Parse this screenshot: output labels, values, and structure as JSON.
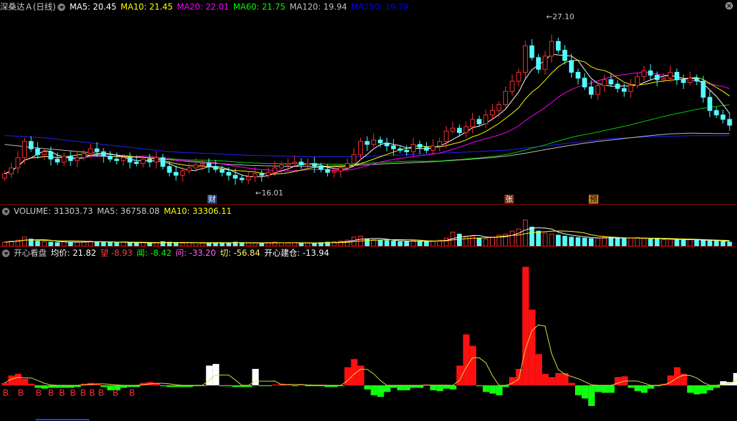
{
  "main_panel": {
    "title": "深桑达Ａ(日线)",
    "ma_labels": [
      {
        "text": "MA5: 20.45",
        "color": "#ffffff"
      },
      {
        "text": "MA10: 21.45",
        "color": "#ffff00"
      },
      {
        "text": "MA20: 22.01",
        "color": "#ff00ff"
      },
      {
        "text": "MA60: 21.75",
        "color": "#00ff00"
      },
      {
        "text": "MA120: 19.94",
        "color": "#c0c0c0"
      },
      {
        "text": "MA250: 19.79",
        "color": "#0000ff"
      }
    ],
    "high_label": "27.10",
    "low_label": "16.01",
    "badges": [
      {
        "text": "财",
        "bg": "#204080",
        "color": "#ffffff"
      },
      {
        "text": "张",
        "bg": "#7a2a10",
        "color": "#ffffff"
      },
      {
        "text": "预",
        "bg": "#c87a20",
        "color": "#000000"
      }
    ]
  },
  "volume_panel": {
    "title": "VOLUME: 31303.73",
    "ma5": "MA5: 36758.08",
    "ma10": "MA10: 33306.11"
  },
  "indicator_panel": {
    "title": "开心看盘",
    "items": [
      {
        "text": "均价: 21.82",
        "color": "#ffffff"
      },
      {
        "text": "望 -8.93",
        "color": "#ff4040"
      },
      {
        "text": "闻: -8.42",
        "color": "#00ff00"
      },
      {
        "text": "问: -33.20",
        "color": "#ff66ff"
      },
      {
        "text": "切: -56.84",
        "color": "#ffff66"
      },
      {
        "text": "开心建仓: -13.94",
        "color": "#ffffff"
      }
    ],
    "signal_label": "B"
  },
  "chart_data": {
    "type": "candlestick",
    "price_range": [
      15.5,
      27.8
    ],
    "high": 27.1,
    "low": 16.01,
    "closes": [
      17.2,
      17.6,
      18.3,
      19.4,
      18.9,
      18.5,
      18.7,
      18.2,
      18.0,
      18.4,
      18.1,
      18.3,
      18.6,
      18.9,
      18.7,
      18.4,
      18.2,
      18.1,
      18.3,
      18.0,
      17.9,
      18.2,
      18.0,
      18.3,
      17.7,
      17.3,
      17.1,
      17.4,
      17.6,
      17.8,
      17.9,
      17.7,
      17.5,
      17.3,
      17.1,
      16.9,
      16.8,
      17.0,
      17.2,
      17.1,
      17.3,
      17.6,
      17.8,
      17.9,
      18.0,
      17.8,
      17.9,
      17.7,
      17.5,
      17.3,
      17.4,
      17.6,
      17.9,
      18.5,
      19.4,
      19.2,
      19.5,
      19.3,
      19.1,
      18.9,
      18.8,
      18.7,
      19.2,
      19.0,
      18.8,
      19.1,
      19.4,
      20.1,
      20.3,
      20.0,
      20.4,
      20.9,
      20.6,
      21.2,
      21.5,
      21.9,
      22.8,
      23.5,
      24.1,
      25.9,
      25.1,
      24.3,
      25.2,
      26.2,
      25.6,
      24.9,
      24.1,
      23.7,
      23.1,
      22.6,
      23.2,
      23.6,
      23.3,
      23.0,
      22.8,
      23.2,
      23.8,
      24.2,
      23.9,
      23.6,
      23.7,
      24.1,
      23.6,
      23.4,
      23.7,
      23.5,
      22.4,
      21.5,
      21.2,
      20.9,
      20.5
    ],
    "opens": [
      16.9,
      17.2,
      17.6,
      18.3,
      19.4,
      18.9,
      18.5,
      18.7,
      18.2,
      18.0,
      18.4,
      18.1,
      18.3,
      18.6,
      18.9,
      18.7,
      18.4,
      18.2,
      18.1,
      18.3,
      18.0,
      17.9,
      18.2,
      18.0,
      18.3,
      17.7,
      17.3,
      17.1,
      17.4,
      17.6,
      17.8,
      17.9,
      17.7,
      17.5,
      17.3,
      17.1,
      16.9,
      16.8,
      17.0,
      17.2,
      17.1,
      17.3,
      17.6,
      17.8,
      17.9,
      18.0,
      17.8,
      17.9,
      17.7,
      17.5,
      17.3,
      17.4,
      17.6,
      17.9,
      18.5,
      19.4,
      19.2,
      19.5,
      19.3,
      19.1,
      18.9,
      18.8,
      18.7,
      19.2,
      19.0,
      18.8,
      19.1,
      19.4,
      20.1,
      20.3,
      20.0,
      20.4,
      20.9,
      20.6,
      21.2,
      21.5,
      21.9,
      22.8,
      23.5,
      24.1,
      25.9,
      25.1,
      24.3,
      25.2,
      26.2,
      25.6,
      24.9,
      24.1,
      23.7,
      23.1,
      22.6,
      23.2,
      23.6,
      23.3,
      23.0,
      22.8,
      23.2,
      23.8,
      24.2,
      23.9,
      23.6,
      23.7,
      24.1,
      23.6,
      23.4,
      23.7,
      23.5,
      22.4,
      21.5,
      21.2,
      20.9
    ],
    "ma250": [
      19.8,
      19.78,
      19.75,
      19.72,
      19.7,
      19.68,
      19.65,
      19.6,
      19.55,
      19.5,
      19.45,
      19.4,
      19.35,
      19.3,
      19.25,
      19.2,
      19.15,
      19.1,
      19.05,
      19.0,
      18.95,
      18.9,
      18.85,
      18.8,
      18.75,
      18.7,
      18.68,
      18.66,
      18.64,
      18.62,
      18.6,
      18.58,
      18.56,
      18.54,
      18.52,
      18.5,
      18.48,
      18.46,
      18.45,
      18.44,
      18.43,
      18.42,
      18.41,
      18.4,
      18.39,
      18.38,
      18.37,
      18.36,
      18.36,
      18.36,
      18.36,
      18.36,
      18.36,
      18.37,
      18.38,
      18.39,
      18.4,
      18.42,
      18.44,
      18.46,
      18.48,
      18.5,
      18.52,
      18.54,
      18.56,
      18.58,
      18.6,
      18.62,
      18.64,
      18.66,
      18.68,
      18.7,
      18.72,
      18.74,
      18.76,
      18.78,
      18.8,
      18.85,
      18.9,
      18.95,
      19.0,
      19.05,
      19.1,
      19.15,
      19.2,
      19.25,
      19.3,
      19.35,
      19.4,
      19.45,
      19.5,
      19.55,
      19.6,
      19.62,
      19.64,
      19.66,
      19.68,
      19.7,
      19.72,
      19.74,
      19.75,
      19.76,
      19.77,
      19.78,
      19.79,
      19.79,
      19.79,
      19.79,
      19.79,
      19.79,
      19.79
    ],
    "ma120": [
      19.2,
      19.15,
      19.1,
      19.05,
      19.0,
      18.96,
      18.92,
      18.88,
      18.84,
      18.8,
      18.76,
      18.72,
      18.68,
      18.64,
      18.6,
      18.56,
      18.52,
      18.48,
      18.44,
      18.4,
      18.36,
      18.32,
      18.28,
      18.24,
      18.2,
      18.16,
      18.12,
      18.08,
      18.04,
      18.0,
      17.97,
      17.94,
      17.91,
      17.88,
      17.85,
      17.82,
      17.8,
      17.78,
      17.76,
      17.75,
      17.74,
      17.73,
      17.72,
      17.71,
      17.7,
      17.7,
      17.7,
      17.7,
      17.71,
      17.72,
      17.73,
      17.74,
      17.76,
      17.78,
      17.8,
      17.82,
      17.84,
      17.86,
      17.88,
      17.9,
      17.92,
      17.94,
      17.96,
      17.98,
      18.0,
      18.02,
      18.05,
      18.08,
      18.11,
      18.14,
      18.17,
      18.2,
      18.23,
      18.27,
      18.31,
      18.35,
      18.4,
      18.46,
      18.53,
      18.6,
      18.68,
      18.76,
      18.84,
      18.92,
      19.0,
      19.08,
      19.15,
      19.22,
      19.28,
      19.34,
      19.4,
      19.45,
      19.5,
      19.55,
      19.6,
      19.65,
      19.7,
      19.75,
      19.8,
      19.84,
      19.88,
      19.91,
      19.93,
      19.95,
      19.96,
      19.96,
      19.95,
      19.95,
      19.94,
      19.94,
      19.94
    ],
    "volumes": [
      8,
      10,
      12,
      18,
      14,
      10,
      9,
      8,
      7,
      9,
      8,
      8,
      9,
      10,
      9,
      8,
      7,
      7,
      8,
      7,
      6,
      7,
      6,
      7,
      9,
      8,
      7,
      6,
      7,
      7,
      6,
      6,
      7,
      6,
      7,
      8,
      7,
      6,
      6,
      6,
      7,
      8,
      7,
      6,
      7,
      6,
      6,
      6,
      7,
      8,
      9,
      10,
      12,
      18,
      20,
      14,
      13,
      12,
      11,
      10,
      9,
      9,
      11,
      10,
      9,
      10,
      12,
      16,
      28,
      24,
      18,
      20,
      16,
      14,
      18,
      22,
      24,
      30,
      34,
      52,
      38,
      30,
      26,
      24,
      22,
      20,
      18,
      17,
      16,
      15,
      16,
      18,
      17,
      16,
      15,
      16,
      17,
      15,
      14,
      14,
      13,
      14,
      13,
      12,
      13,
      12,
      11,
      10,
      10,
      9,
      8
    ],
    "indicator": [
      3,
      12,
      14,
      8,
      2,
      -3,
      -4,
      -3,
      -3,
      -3,
      -3,
      -2,
      2,
      3,
      2,
      -2,
      -6,
      -6,
      -3,
      -2,
      -2,
      3,
      4,
      3,
      -1,
      -2,
      -2,
      -2,
      -2,
      -1,
      -1,
      24,
      26,
      -1,
      -1,
      -2,
      -2,
      -2,
      20,
      -1,
      -1,
      1,
      2,
      1,
      -1,
      1,
      -1,
      -1,
      -1,
      -2,
      -2,
      -1,
      22,
      32,
      24,
      -5,
      -12,
      -14,
      -8,
      -3,
      -6,
      -6,
      -3,
      -3,
      1,
      -6,
      -7,
      -4,
      -5,
      24,
      62,
      48,
      -1,
      -8,
      -10,
      -12,
      -2,
      10,
      20,
      144,
      92,
      38,
      14,
      10,
      15,
      15,
      3,
      -12,
      -16,
      -25,
      -8,
      -9,
      -9,
      10,
      11,
      -3,
      -7,
      -9,
      -4,
      -1,
      2,
      12,
      22,
      14,
      -9,
      -11,
      -10,
      -6,
      -3,
      5,
      4,
      15,
      17,
      16
    ]
  }
}
